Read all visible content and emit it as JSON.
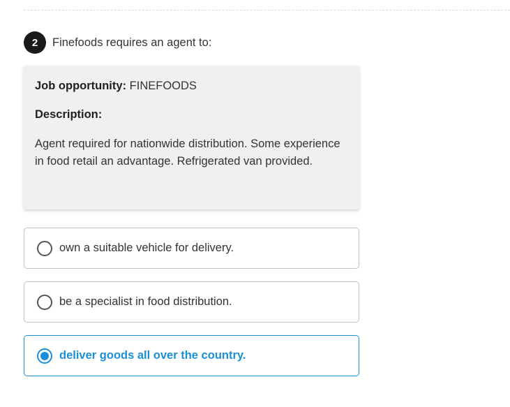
{
  "question": {
    "number": "2",
    "text": "Finefoods requires an agent to:"
  },
  "job_card": {
    "opportunity_label": "Job opportunity:",
    "opportunity_value": "FINEFOODS",
    "description_label": "Description:",
    "description_text": "Agent required for nationwide distribution. Some experience in food retail an advantage. Refrigerated van provided."
  },
  "options": [
    {
      "label": "own a suitable vehicle for delivery.",
      "selected": false
    },
    {
      "label": "be a specialist in food distribution.",
      "selected": false
    },
    {
      "label": "deliver goods all over the country.",
      "selected": true
    }
  ],
  "colors": {
    "accent": "#1a8fd6",
    "card_background": "#f2f0ef",
    "number_badge": "#1a1a1a"
  }
}
